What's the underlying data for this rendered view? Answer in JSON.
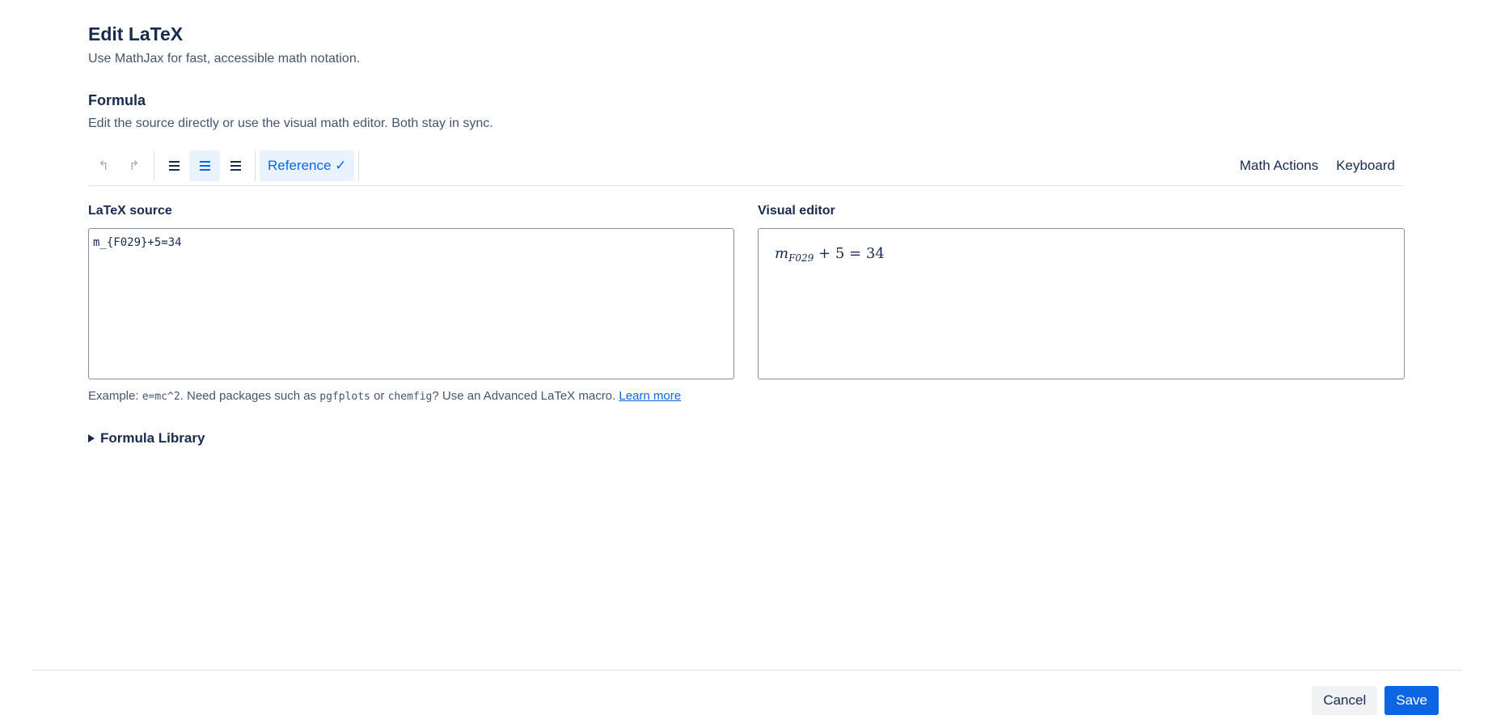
{
  "header": {
    "title": "Edit LaTeX",
    "subtitle": "Use MathJax for fast, accessible math notation."
  },
  "formula": {
    "title": "Formula",
    "description": "Edit the source directly or use the visual math editor. Both stay in sync."
  },
  "toolbar": {
    "undo_glyph": "↰",
    "redo_glyph": "↱",
    "reference_label": "Reference ✓",
    "math_actions_label": "Math Actions",
    "keyboard_label": "Keyboard"
  },
  "source": {
    "label": "LaTeX source",
    "value": "m_{F029}+5=34"
  },
  "visual": {
    "label": "Visual editor",
    "var": "m",
    "sub": "F029",
    "rest": " + 5 = 34"
  },
  "hint": {
    "prefix": "Example: ",
    "example": "e=mc^2",
    "mid1": ". Need packages such as ",
    "pkg1": "pgfplots",
    "mid2": " or ",
    "pkg2": "chemfig",
    "mid3": "? Use an Advanced LaTeX macro. ",
    "link": "Learn more"
  },
  "library": {
    "label": "Formula Library"
  },
  "footer": {
    "cancel_label": "Cancel",
    "save_label": "Save"
  },
  "colors": {
    "primary": "#0c66e4",
    "text": "#172b4d",
    "subtle": "#44546f",
    "active_bg": "#e9f2ff"
  }
}
